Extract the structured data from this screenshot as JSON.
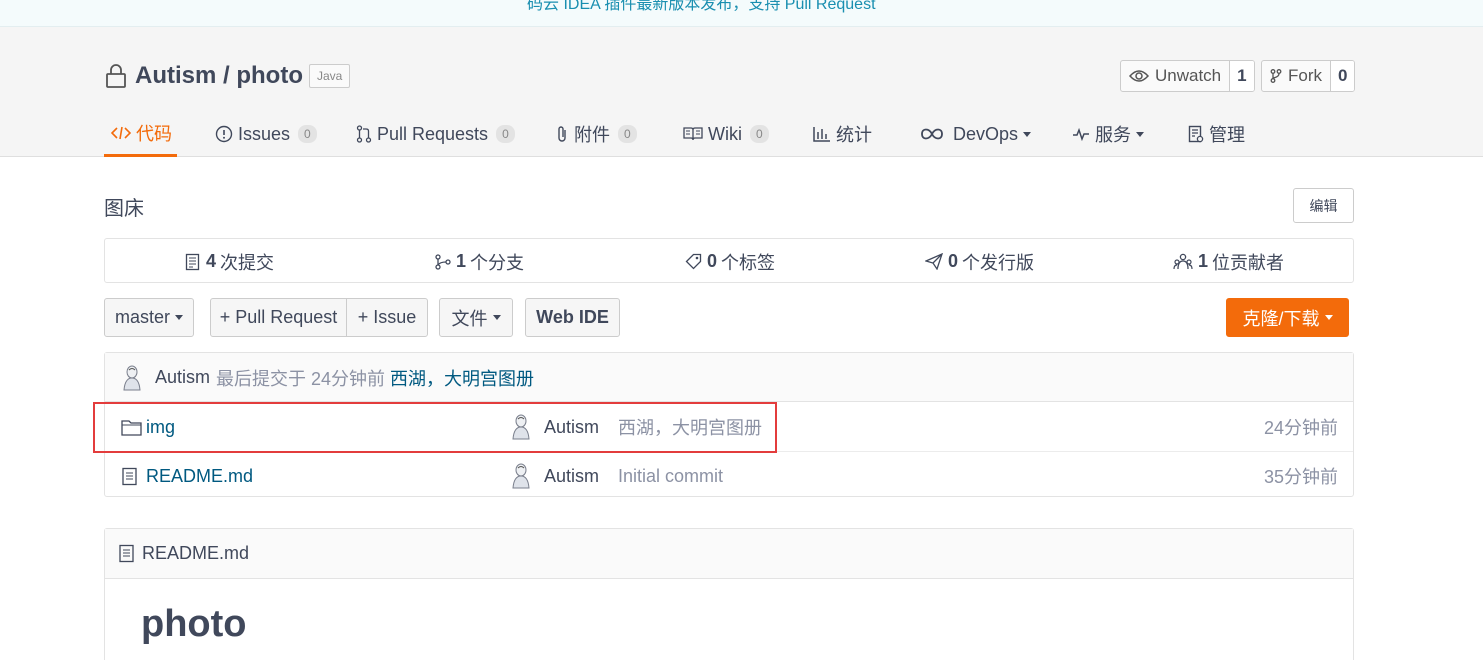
{
  "banner": {
    "text": "码云 IDEA 插件最新版本发布，支持 Pull Request"
  },
  "repo": {
    "name": "Autism / photo",
    "language": "Java",
    "unwatch_label": "Unwatch",
    "unwatch_count": "1",
    "fork_label": "Fork",
    "fork_count": "0"
  },
  "tabs": [
    {
      "label": "代码",
      "icon": "code-icon"
    },
    {
      "label": "Issues",
      "count": "0",
      "icon": "issue-icon"
    },
    {
      "label": "Pull Requests",
      "count": "0",
      "icon": "pull-request-icon"
    },
    {
      "label": "附件",
      "count": "0",
      "icon": "paperclip-icon"
    },
    {
      "label": "Wiki",
      "count": "0",
      "icon": "book-icon"
    },
    {
      "label": "统计",
      "icon": "bar-chart-icon"
    },
    {
      "label": "DevOps",
      "icon": "infinity-icon"
    },
    {
      "label": "服务",
      "icon": "pulse-icon"
    },
    {
      "label": "管理",
      "icon": "settings-doc-icon"
    }
  ],
  "description": "图床",
  "edit_label": "编辑",
  "stats": [
    {
      "count": "4",
      "label": "次提交",
      "icon": "commit-icon"
    },
    {
      "count": "1",
      "label": "个分支",
      "icon": "branch-icon"
    },
    {
      "count": "0",
      "label": "个标签",
      "icon": "tag-icon"
    },
    {
      "count": "0",
      "label": "个发行版",
      "icon": "release-icon"
    },
    {
      "count": "1",
      "label": "位贡献者",
      "icon": "contributors-icon"
    }
  ],
  "toolbar": {
    "branch": "master",
    "pull_request": "+ Pull Request",
    "issue": "+ Issue",
    "file": "文件",
    "web_ide": "Web IDE",
    "clone": "克隆/下载"
  },
  "last_commit": {
    "author": "Autism",
    "text": "最后提交于 24分钟前",
    "message": "西湖，大明宫图册"
  },
  "files": [
    {
      "name": "img",
      "type": "folder",
      "author": "Autism",
      "message": "西湖，大明宫图册",
      "time": "24分钟前"
    },
    {
      "name": "README.md",
      "type": "file",
      "author": "Autism",
      "message": "Initial commit",
      "time": "35分钟前"
    }
  ],
  "readme": {
    "filename": "README.md",
    "heading": "photo"
  },
  "colors": {
    "accent": "#f36b0b",
    "link": "#005980",
    "highlight": "#e33c3c"
  }
}
